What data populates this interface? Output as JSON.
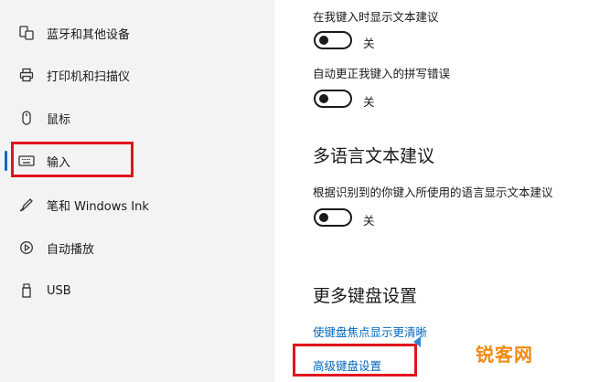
{
  "sidebar": {
    "items": [
      {
        "label": "蓝牙和其他设备",
        "icon": "bluetooth-devices-icon"
      },
      {
        "label": "打印机和扫描仪",
        "icon": "printer-icon"
      },
      {
        "label": "鼠标",
        "icon": "mouse-icon"
      },
      {
        "label": "输入",
        "icon": "keyboard-icon",
        "selected": true
      },
      {
        "label": "笔和 Windows Ink",
        "icon": "pen-icon"
      },
      {
        "label": "自动播放",
        "icon": "autoplay-icon"
      },
      {
        "label": "USB",
        "icon": "usb-icon"
      }
    ]
  },
  "main": {
    "setting1": {
      "label": "在我键入时显示文本建议",
      "state": "关"
    },
    "setting2": {
      "label": "自动更正我键入的拼写错误",
      "state": "关"
    },
    "section_multilang": {
      "heading": "多语言文本建议"
    },
    "setting3": {
      "label": "根据识别到的你键入所使用的语言显示文本建议",
      "state": "关"
    },
    "section_more": {
      "heading": "更多键盘设置"
    },
    "link_focus": "使键盘焦点显示更清晰",
    "link_advanced": "高级键盘设置"
  },
  "watermark": "锐客网",
  "colors": {
    "accent": "#0067c0",
    "highlight_box": "#e0141e",
    "watermark": "#f08a12"
  }
}
